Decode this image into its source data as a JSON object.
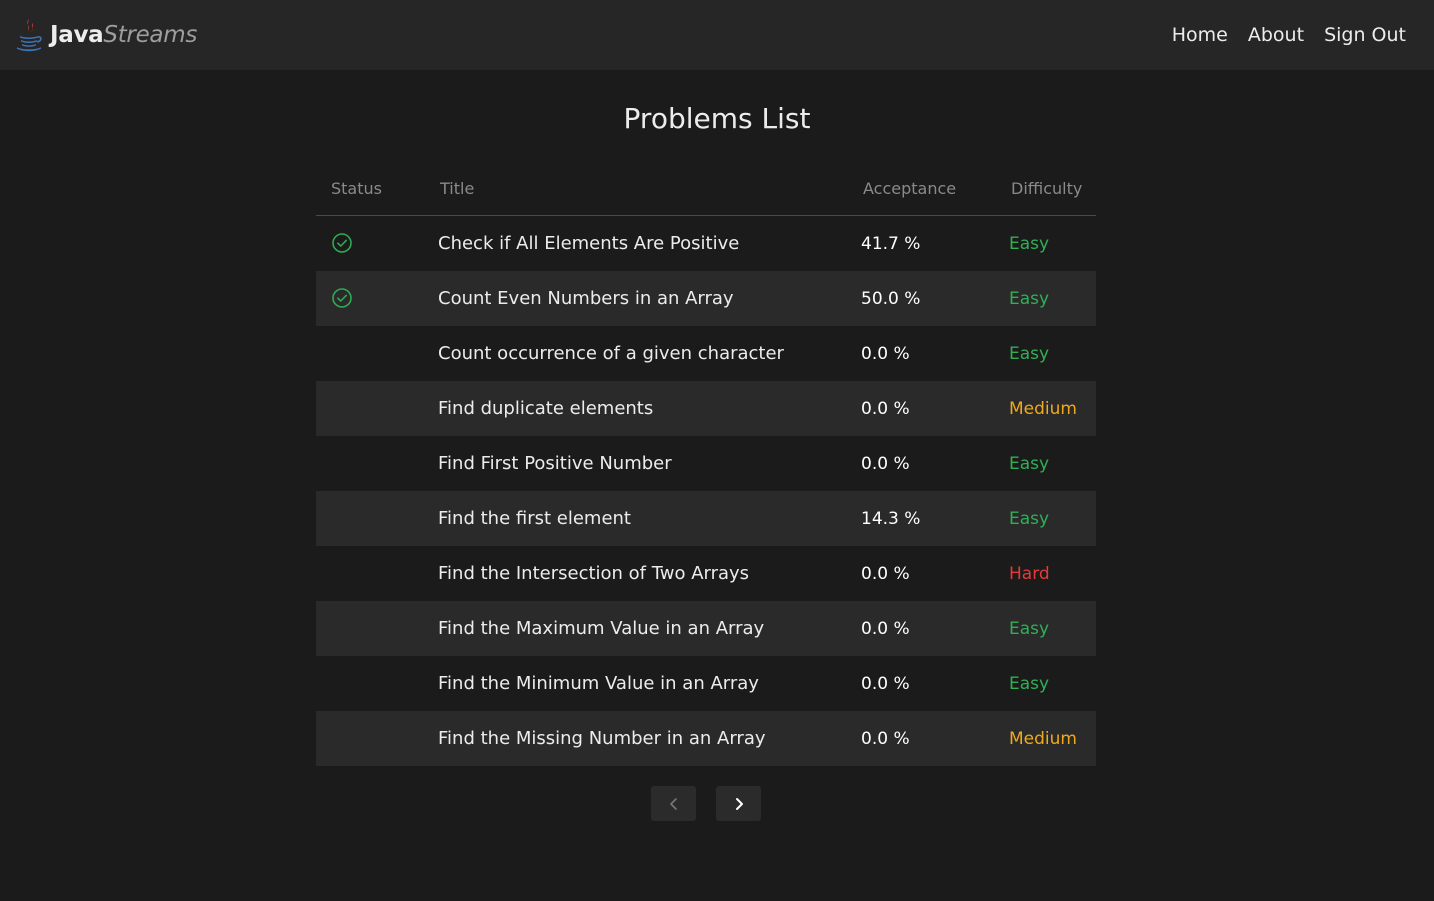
{
  "brand": {
    "name_bold": "Java",
    "name_italic": "Streams",
    "logo_icon": "java-coffee-cup-icon"
  },
  "nav": {
    "links": [
      "Home",
      "About",
      "Sign Out"
    ]
  },
  "page_title": "Problems List",
  "table": {
    "headers": {
      "status": "Status",
      "title": "Title",
      "acceptance": "Acceptance",
      "difficulty": "Difficulty"
    },
    "rows": [
      {
        "solved": true,
        "title": "Check if All Elements Are Positive",
        "acceptance": "41.7 %",
        "difficulty": "Easy"
      },
      {
        "solved": true,
        "title": "Count Even Numbers in an Array",
        "acceptance": "50.0 %",
        "difficulty": "Easy"
      },
      {
        "solved": false,
        "title": "Count occurrence of a given character",
        "acceptance": "0.0 %",
        "difficulty": "Easy"
      },
      {
        "solved": false,
        "title": "Find duplicate elements",
        "acceptance": "0.0 %",
        "difficulty": "Medium"
      },
      {
        "solved": false,
        "title": "Find First Positive Number",
        "acceptance": "0.0 %",
        "difficulty": "Easy"
      },
      {
        "solved": false,
        "title": "Find the first element",
        "acceptance": "14.3 %",
        "difficulty": "Easy"
      },
      {
        "solved": false,
        "title": "Find the Intersection of Two Arrays",
        "acceptance": "0.0 %",
        "difficulty": "Hard"
      },
      {
        "solved": false,
        "title": "Find the Maximum Value in an Array",
        "acceptance": "0.0 %",
        "difficulty": "Easy"
      },
      {
        "solved": false,
        "title": "Find the Minimum Value in an Array",
        "acceptance": "0.0 %",
        "difficulty": "Easy"
      },
      {
        "solved": false,
        "title": "Find the Missing Number in an Array",
        "acceptance": "0.0 %",
        "difficulty": "Medium"
      }
    ]
  },
  "colors": {
    "background": "#1b1b1b",
    "navbar": "#262626",
    "solved_icon": "#2faa54",
    "easy": "#2fb055",
    "medium": "#f0a91b",
    "hard": "#e53a3a",
    "java_red": "#e24236",
    "java_blue": "#3c74b8"
  },
  "pagination": {
    "prev_icon": "chevron-left-icon",
    "next_icon": "chevron-right-icon",
    "prev_enabled": false,
    "next_enabled": true
  }
}
